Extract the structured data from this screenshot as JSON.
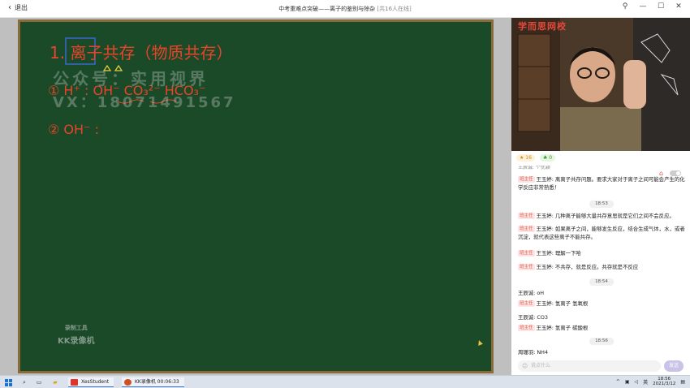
{
  "titlebar": {
    "back_label": "退出",
    "title": "中考重难点突破——离子的鉴别与除杂",
    "online": "[共16人在线]",
    "controls": [
      "pin-icon",
      "minimize-icon",
      "maximize-icon",
      "close-icon"
    ]
  },
  "board": {
    "line1": "1. 离子共存（物质共存）",
    "line2": "① H⁺ : OH⁻  CO₃²⁻  HCO₃⁻",
    "line3": "② OH⁻ :",
    "watermark_1": "公众号：实用视界",
    "watermark_2": "VX：18071491567",
    "recorder_1": "录制工具",
    "recorder_2": "KK录像机",
    "colors": {
      "board": "#1a4a28",
      "ink": "#e8442a",
      "highlight": "#3a68d0",
      "yellow": "#e8d040"
    }
  },
  "video": {
    "logo": "学而思网校"
  },
  "stats": {
    "likes": "16",
    "gifts": "0"
  },
  "chat": {
    "cutoff_name": "王辰诚: 个优颖",
    "messages": [
      {
        "badge": "班主任",
        "name": "王玉婷",
        "text": "离离子共存问题。要求大家对于离子之间可能会产生的化学反应非常熟悉！"
      },
      {
        "time": "18:53"
      },
      {
        "badge": "班主任",
        "name": "王玉婷",
        "text": "几种离子能够大量共存意思就是它们之间不会反应。"
      },
      {
        "badge": "班主任",
        "name": "王玉婷",
        "text": "如果离子之间，能够发生反应，结合生成气体，水，或者沉淀，就代表这些离子不能共存。"
      },
      {
        "badge": "班主任",
        "name": "王玉婷",
        "text": "理解一下哈"
      },
      {
        "badge": "班主任",
        "name": "王玉婷",
        "text": "不共存，就是反应。共存就是不反应"
      },
      {
        "time": "18:54"
      },
      {
        "name": "王辰诚",
        "text": "oH"
      },
      {
        "badge": "班主任",
        "name": "王玉婷",
        "text": "氢离子 氢氧根"
      },
      {
        "name": "王辰诚",
        "text": "CO3"
      },
      {
        "badge": "班主任",
        "name": "王玉婷",
        "text": "氢离子 碳酸根"
      },
      {
        "time": "18:56"
      },
      {
        "name": "周珊羽",
        "text": "NH4"
      }
    ]
  },
  "input": {
    "placeholder": "说点什么",
    "send_label": "发送"
  },
  "taskbar": {
    "apps": [
      {
        "label": "XesStudent",
        "color": "#e0342a"
      },
      {
        "label": "KK录像机 00:06:33",
        "color": "#d05020"
      }
    ],
    "tray_lang": "英",
    "time": "18:56",
    "date": "2021/3/12"
  }
}
